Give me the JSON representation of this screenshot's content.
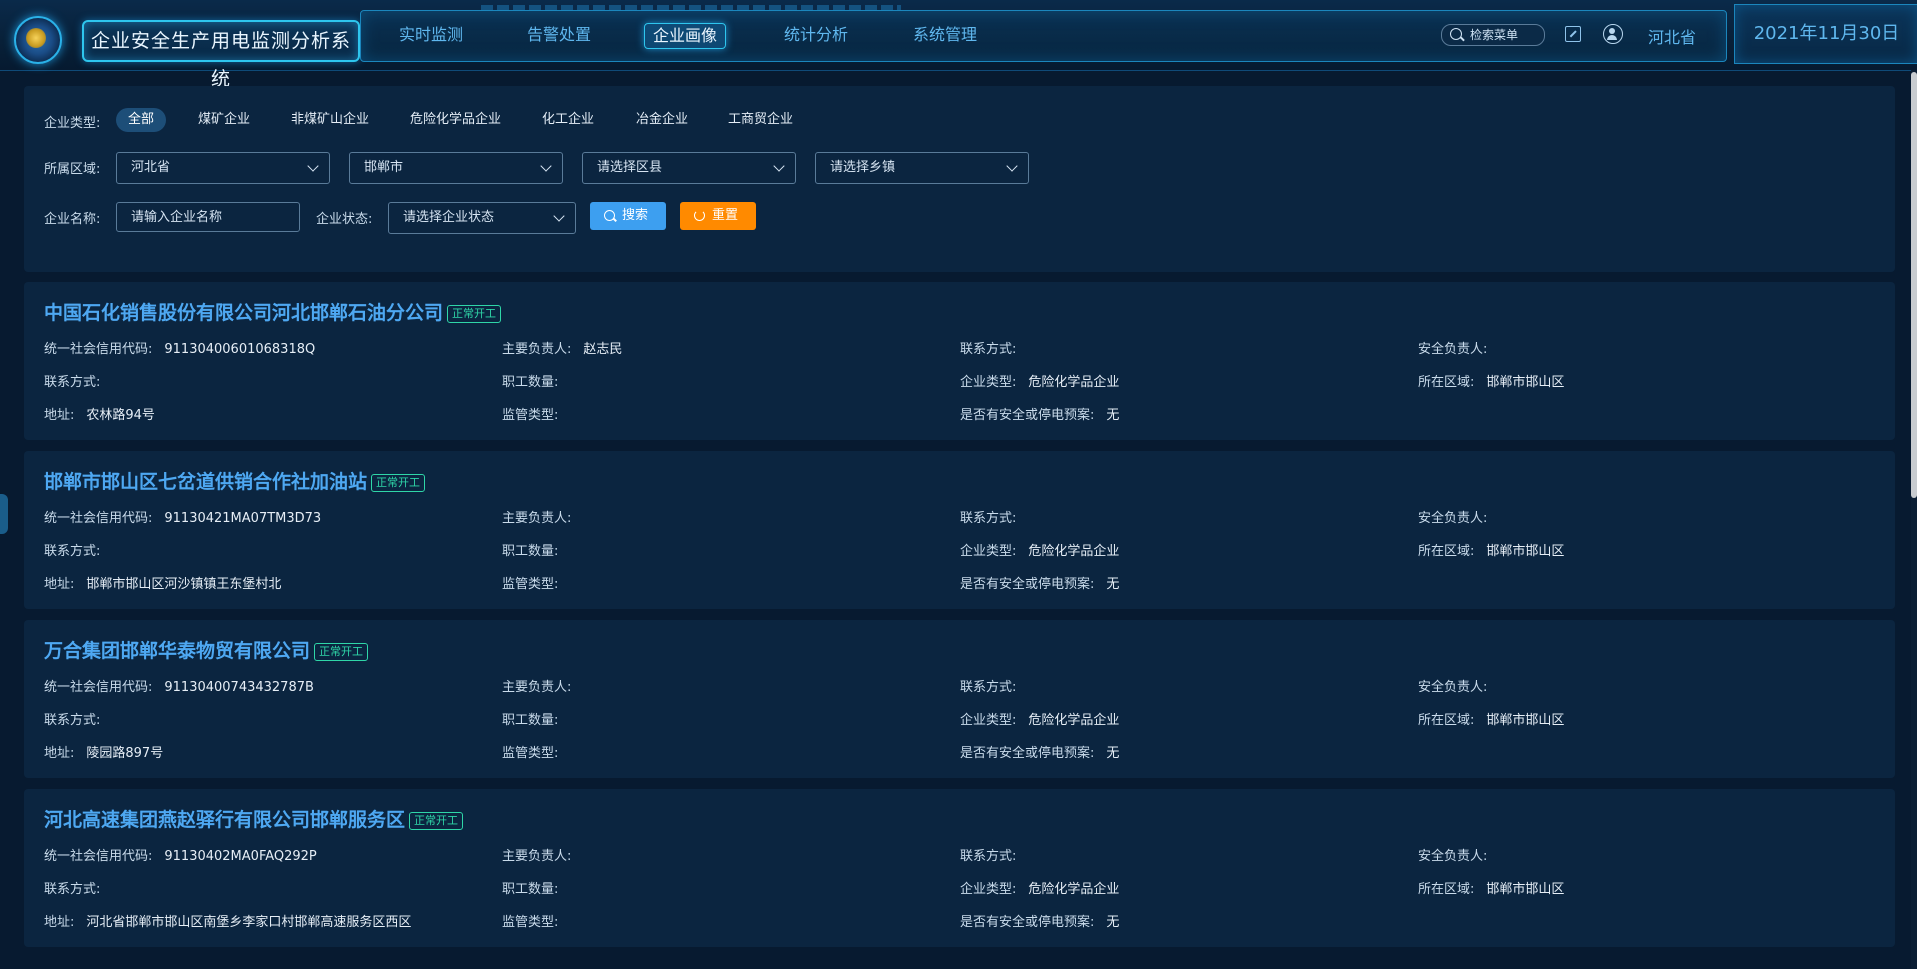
{
  "header": {
    "system_title": "企业安全生产用电监测分析系统",
    "nav": [
      "实时监测",
      "告警处置",
      "企业画像",
      "统计分析",
      "系统管理"
    ],
    "active_nav": "企业画像",
    "search_menu_label": "检索菜单",
    "region": "河北省",
    "date": "2021年11月30日"
  },
  "filters": {
    "type_label": "企业类型:",
    "types": [
      "全部",
      "煤矿企业",
      "非煤矿山企业",
      "危险化学品企业",
      "化工企业",
      "冶金企业",
      "工商贸企业"
    ],
    "active_type": "全部",
    "region_label": "所属区域:",
    "province": "河北省",
    "city": "邯郸市",
    "county_placeholder": "请选择区县",
    "town_placeholder": "请选择乡镇",
    "name_label": "企业名称:",
    "name_placeholder": "请输入企业名称",
    "status_label": "企业状态:",
    "status_placeholder": "请选择企业状态",
    "search_button": "搜索",
    "reset_button": "重置"
  },
  "labels": {
    "credit_code": "统一社会信用代码:",
    "principal": "主要负责人:",
    "contact": "联系方式:",
    "safety_officer": "安全负责人:",
    "employees": "职工数量:",
    "company_type": "企业类型:",
    "area": "所在区域:",
    "address": "地址:",
    "supervision_type": "监管类型:",
    "emergency_plan": "是否有安全或停电预案:"
  },
  "companies": [
    {
      "name": "中国石化销售股份有限公司河北邯郸石油分公司",
      "status": "正常开工",
      "credit_code": "91130400601068318Q",
      "principal": "赵志民",
      "contact": "",
      "safety_officer": "",
      "contact2": "",
      "employees": "",
      "company_type": "危险化学品企业",
      "area": "邯郸市邯山区",
      "address": "农林路94号",
      "supervision_type": "",
      "emergency_plan": "无"
    },
    {
      "name": "邯郸市邯山区七岔道供销合作社加油站",
      "status": "正常开工",
      "credit_code": "91130421MA07TM3D73",
      "principal": "",
      "contact": "",
      "safety_officer": "",
      "contact2": "",
      "employees": "",
      "company_type": "危险化学品企业",
      "area": "邯郸市邯山区",
      "address": "邯郸市邯山区河沙镇镇王东堡村北",
      "supervision_type": "",
      "emergency_plan": "无"
    },
    {
      "name": "万合集团邯郸华泰物贸有限公司",
      "status": "正常开工",
      "credit_code": "91130400743432787B",
      "principal": "",
      "contact": "",
      "safety_officer": "",
      "contact2": "",
      "employees": "",
      "company_type": "危险化学品企业",
      "area": "邯郸市邯山区",
      "address": "陵园路897号",
      "supervision_type": "",
      "emergency_plan": "无"
    },
    {
      "name": "河北高速集团燕赵驿行有限公司邯郸服务区",
      "status": "正常开工",
      "credit_code": "91130402MA0FAQ292P",
      "principal": "",
      "contact": "",
      "safety_officer": "",
      "contact2": "",
      "employees": "",
      "company_type": "危险化学品企业",
      "area": "邯郸市邯山区",
      "address": "河北省邯郸市邯山区南堡乡李家口村邯郸高速服务区西区",
      "supervision_type": "",
      "emergency_plan": "无"
    }
  ]
}
